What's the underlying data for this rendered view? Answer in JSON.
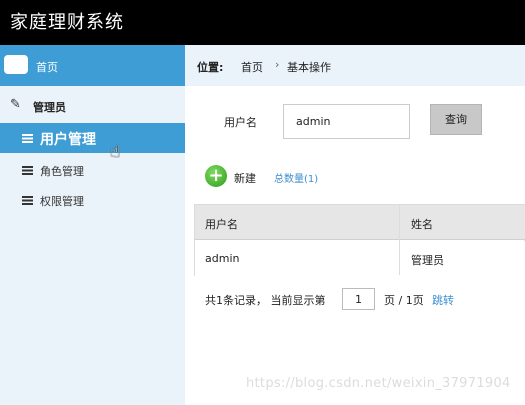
{
  "app": {
    "title": "家庭理财系统"
  },
  "sidebar": {
    "home": {
      "label": "首页",
      "icon": "cloud-icon"
    },
    "section": {
      "label": "管理员",
      "icon": "edit-icon"
    },
    "items": [
      {
        "label": "用户管理",
        "active": true,
        "icon": "list-icon"
      },
      {
        "label": "角色管理",
        "active": false,
        "icon": "list-icon"
      },
      {
        "label": "权限管理",
        "active": false,
        "icon": "list-icon"
      }
    ]
  },
  "breadcrumb": {
    "label": "位置:",
    "home": "首页",
    "separator": "›",
    "current": "基本操作"
  },
  "search": {
    "label": "用户名",
    "value": "admin",
    "button": "查询"
  },
  "toolbar": {
    "add_label": "新建",
    "total_label": "总数量(1)"
  },
  "table": {
    "columns": [
      "用户名",
      "姓名"
    ],
    "rows": [
      [
        "admin",
        "管理员"
      ]
    ]
  },
  "pager": {
    "summary": "共1条记录， 当前显示第",
    "page_input": "1",
    "total": "页 / 1页",
    "jump": "跳转"
  },
  "watermark": "https://blog.csdn.net/weixin_37971904",
  "colors": {
    "accent": "#3d9dd4",
    "topbar": "#000000",
    "sidebar_bg": "#eaf3fa",
    "link": "#3d8fd0"
  }
}
